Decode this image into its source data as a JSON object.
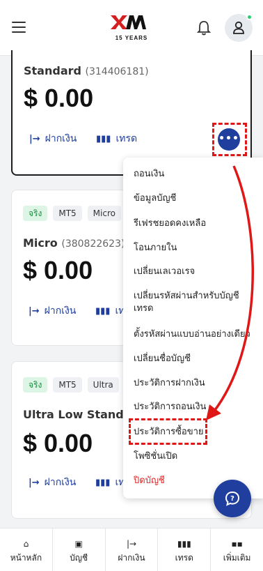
{
  "header": {
    "logo_main": "XM",
    "logo_sub": "15 YEARS"
  },
  "accounts": [
    {
      "name": "Standard",
      "number": "(314406181)",
      "balance": "$ 0.00",
      "deposit": "ฝากเงิน",
      "trade": "เทรด"
    },
    {
      "badges": [
        "จริง",
        "MT5",
        "Micro"
      ],
      "name": "Micro",
      "number": "(380822623)",
      "balance": "$ 0.00",
      "deposit": "ฝากเงิน",
      "trade": "เทรด"
    },
    {
      "badges": [
        "จริง",
        "MT5",
        "Ultra"
      ],
      "name": "Ultra Low Standa",
      "balance": "$ 0.00",
      "deposit": "ฝากเงิน",
      "trade": "เทรด"
    }
  ],
  "more_button": "•••",
  "menu": {
    "items": [
      "ถอนเงิน",
      "ข้อมูลบัญชี",
      "รีเฟรชยอดคงเหลือ",
      "โอนภายใน",
      "เปลี่ยนเลเวอเรจ",
      "เปลี่ยนรหัสผ่านสำหรับบัญชี",
      "เทรด",
      "ตั้งรหัสผ่านแบบอ่านอย่างเดียว",
      "เปลี่ยนชื่อบัญชี",
      "ประวัติการฝากเงิน",
      "ประวัติการถอนเงิน",
      "ประวัติการซื้อขาย",
      "โพซิชั่นเปิด",
      "ปิดบัญชี"
    ]
  },
  "bottom_nav": {
    "tabs": [
      "หน้าหลัก",
      "บัญชี",
      "ฝากเงิน",
      "เทรด",
      "เพิ่มเติม"
    ]
  },
  "colors": {
    "primary": "#1f3e9e",
    "brand_red": "#d51f1f",
    "highlight": "#e01717",
    "danger": "#e02424"
  }
}
